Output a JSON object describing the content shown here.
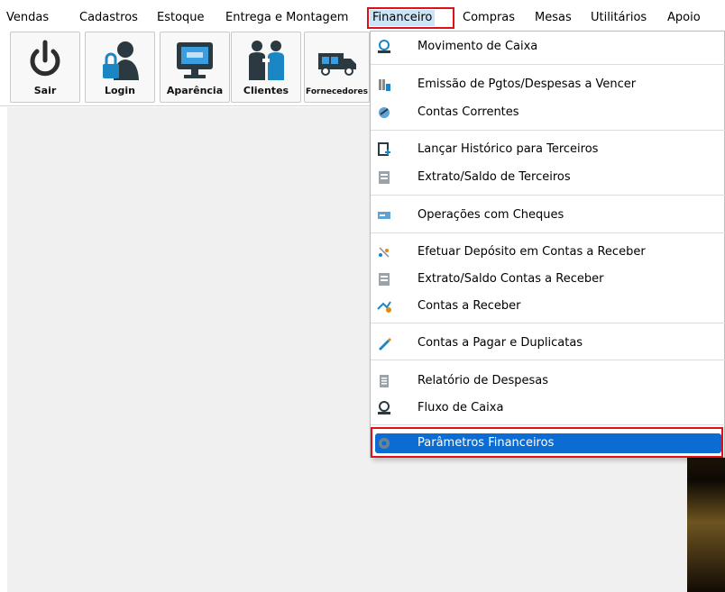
{
  "menubar": {
    "items": [
      {
        "label": "Vendas"
      },
      {
        "label": "Cadastros"
      },
      {
        "label": "Estoque"
      },
      {
        "label": "Entrega e Montagem"
      },
      {
        "label": "Financeiro"
      },
      {
        "label": "Compras"
      },
      {
        "label": "Mesas"
      },
      {
        "label": "Utilitários"
      },
      {
        "label": "Apoio"
      }
    ],
    "active_index": 4,
    "highlight_color": "#e0101b"
  },
  "toolbar": {
    "buttons": [
      {
        "label": "Sair",
        "icon": "power-icon"
      },
      {
        "label": "Login",
        "icon": "user-lock-icon"
      },
      {
        "label": "Aparência",
        "icon": "monitor-icon"
      },
      {
        "label": "Clientes",
        "icon": "people-icon"
      },
      {
        "label": "Fornecedores",
        "icon": "truck-icon"
      }
    ]
  },
  "financeiro_menu": {
    "groups": [
      [
        {
          "label": "Movimento de Caixa",
          "icon": "cash-register-icon"
        }
      ],
      [
        {
          "label": "Emissão de Pgtos/Despesas a Vencer",
          "icon": "payments-icon"
        },
        {
          "label": "Contas Correntes",
          "icon": "accounts-icon"
        }
      ],
      [
        {
          "label": "Lançar Histórico para Terceiros",
          "icon": "history-add-icon"
        },
        {
          "label": "Extrato/Saldo de Terceiros",
          "icon": "statement-icon"
        }
      ],
      [
        {
          "label": "Operações com Cheques",
          "icon": "cheque-icon"
        }
      ],
      [
        {
          "label": "Efetuar Depósito em Contas a Receber",
          "icon": "deposit-icon"
        },
        {
          "label": "Extrato/Saldo Contas a Receber",
          "icon": "statement-icon"
        },
        {
          "label": "Contas a Receber",
          "icon": "receivables-icon"
        }
      ],
      [
        {
          "label": "Contas a Pagar e Duplicatas",
          "icon": "pen-icon"
        }
      ],
      [
        {
          "label": "Relatório de Despesas",
          "icon": "report-icon"
        },
        {
          "label": "Fluxo de Caixa",
          "icon": "cash-flow-icon"
        }
      ],
      [
        {
          "label": "Parâmetros Financeiros",
          "icon": "gear-icon",
          "selected": true
        }
      ]
    ],
    "selected_color": "#0b6cd4"
  }
}
